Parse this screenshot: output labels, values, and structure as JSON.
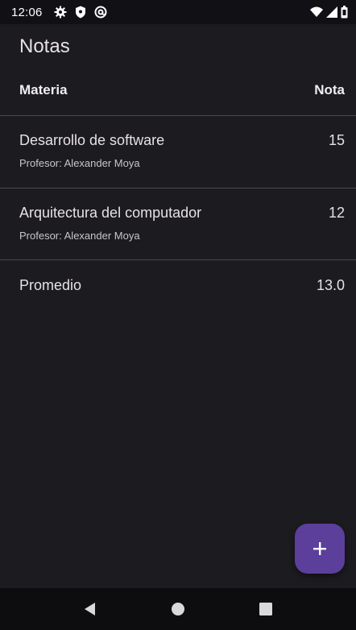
{
  "status_bar": {
    "time": "12:06",
    "left_icons": [
      "gear-icon",
      "shield-icon",
      "at-sign-icon"
    ],
    "right_icons": [
      "wifi-icon",
      "cell-signal-icon",
      "battery-icon"
    ]
  },
  "app": {
    "title": "Notas"
  },
  "table": {
    "header": {
      "subject": "Materia",
      "grade": "Nota"
    },
    "rows": [
      {
        "subject": "Desarrollo de software",
        "grade": "15",
        "teacher": "Profesor: Alexander Moya"
      },
      {
        "subject": "Arquitectura del computador",
        "grade": "12",
        "teacher": "Profesor: Alexander Moya"
      }
    ],
    "average": {
      "label": "Promedio",
      "value": "13.0"
    }
  },
  "fab": {
    "icon": "plus-icon",
    "color": "#5b3f9a"
  },
  "nav_bar": {
    "icons": [
      "back-icon",
      "home-icon",
      "recents-icon"
    ]
  },
  "colors": {
    "background": "#1c1b20",
    "text": "#e6e1e6",
    "divider": "#4a484e"
  }
}
